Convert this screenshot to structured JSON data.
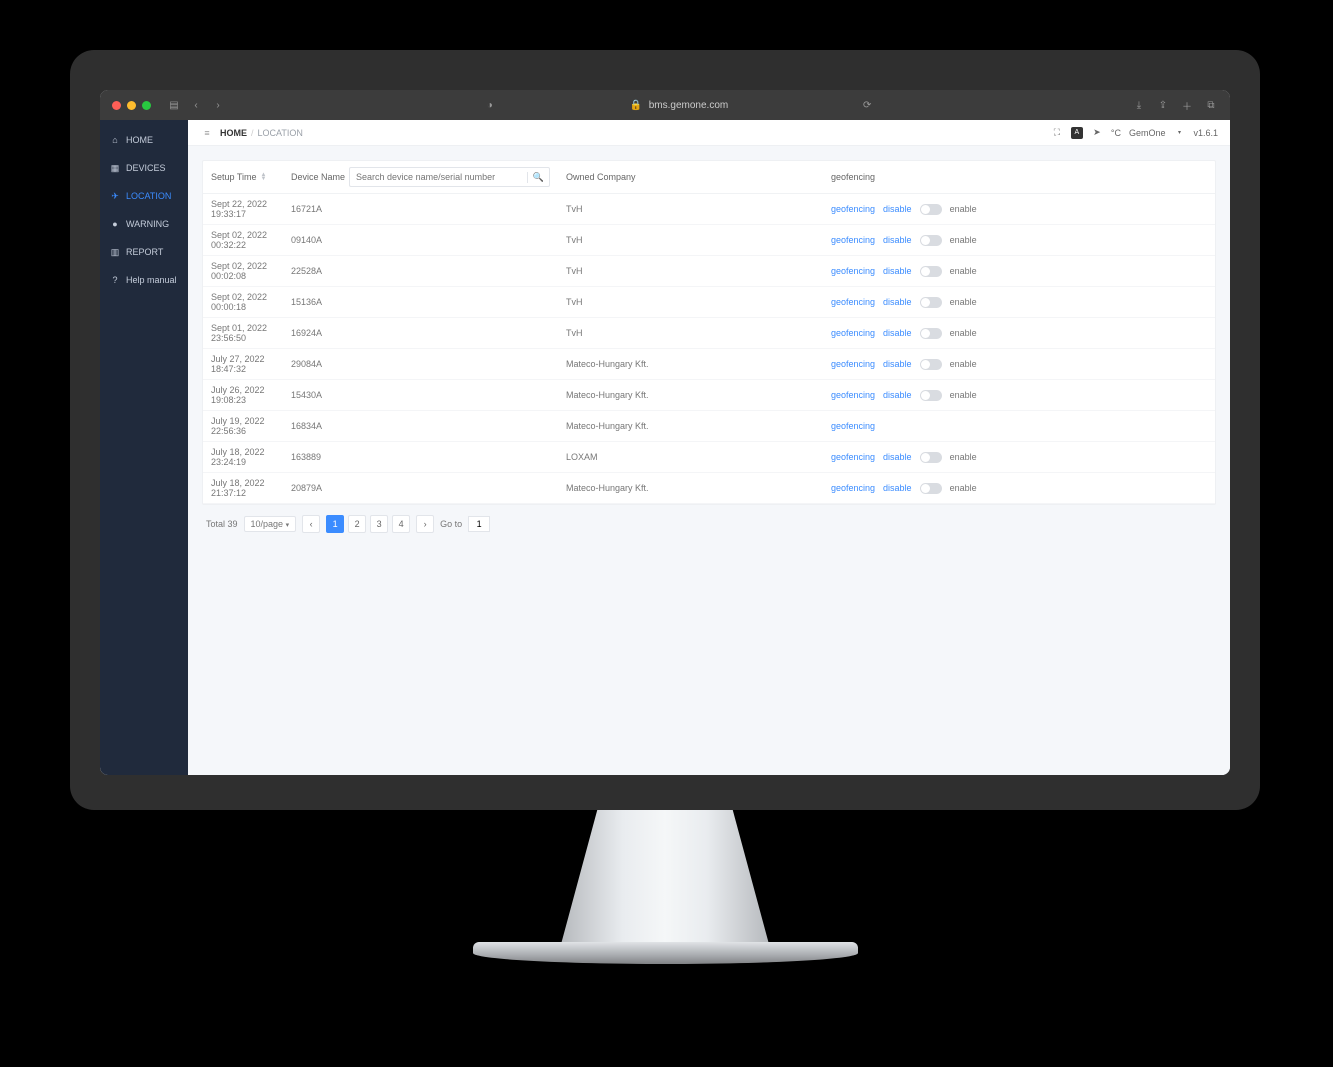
{
  "browser": {
    "url": "bms.gemone.com"
  },
  "sidebar": {
    "items": [
      {
        "label": "HOME",
        "icon": "home-icon"
      },
      {
        "label": "DEVICES",
        "icon": "devices-icon"
      },
      {
        "label": "LOCATION",
        "icon": "location-icon"
      },
      {
        "label": "WARNING",
        "icon": "warning-icon"
      },
      {
        "label": "REPORT",
        "icon": "report-icon"
      },
      {
        "label": "Help manual",
        "icon": "help-icon"
      }
    ],
    "active_index": 2
  },
  "topbar": {
    "crumb_home": "HOME",
    "crumb_current": "LOCATION",
    "temp_unit": "°C",
    "brand": "GemOne",
    "version": "v1.6.1"
  },
  "table": {
    "headers": {
      "setup_time": "Setup Time",
      "device_name": "Device Name",
      "owned_company": "Owned Company",
      "geofencing": "geofencing"
    },
    "search_placeholder": "Search device name/serial number",
    "geo_link": "geofencing",
    "geo_disable": "disable",
    "geo_enable": "enable",
    "rows": [
      {
        "time": "Sept 22, 2022 19:33:17",
        "device": "16721A",
        "company": "TvH",
        "geo_only": false
      },
      {
        "time": "Sept 02, 2022 00:32:22",
        "device": "09140A",
        "company": "TvH",
        "geo_only": false
      },
      {
        "time": "Sept 02, 2022 00:02:08",
        "device": "22528A",
        "company": "TvH",
        "geo_only": false
      },
      {
        "time": "Sept 02, 2022 00:00:18",
        "device": "15136A",
        "company": "TvH",
        "geo_only": false
      },
      {
        "time": "Sept 01, 2022 23:56:50",
        "device": "16924A",
        "company": "TvH",
        "geo_only": false
      },
      {
        "time": "July 27, 2022 18:47:32",
        "device": "29084A",
        "company": "Mateco-Hungary Kft.",
        "geo_only": false
      },
      {
        "time": "July 26, 2022 19:08:23",
        "device": "15430A",
        "company": "Mateco-Hungary Kft.",
        "geo_only": false
      },
      {
        "time": "July 19, 2022 22:56:36",
        "device": "16834A",
        "company": "Mateco-Hungary Kft.",
        "geo_only": true
      },
      {
        "time": "July 18, 2022 23:24:19",
        "device": "163889",
        "company": "LOXAM",
        "geo_only": false
      },
      {
        "time": "July 18, 2022 21:37:12",
        "device": "20879A",
        "company": "Mateco-Hungary Kft.",
        "geo_only": false
      }
    ]
  },
  "pagination": {
    "total_label": "Total 39",
    "per_page": "10/page",
    "pages": [
      "1",
      "2",
      "3",
      "4"
    ],
    "active": "1",
    "goto_label": "Go to",
    "goto_value": "1"
  }
}
